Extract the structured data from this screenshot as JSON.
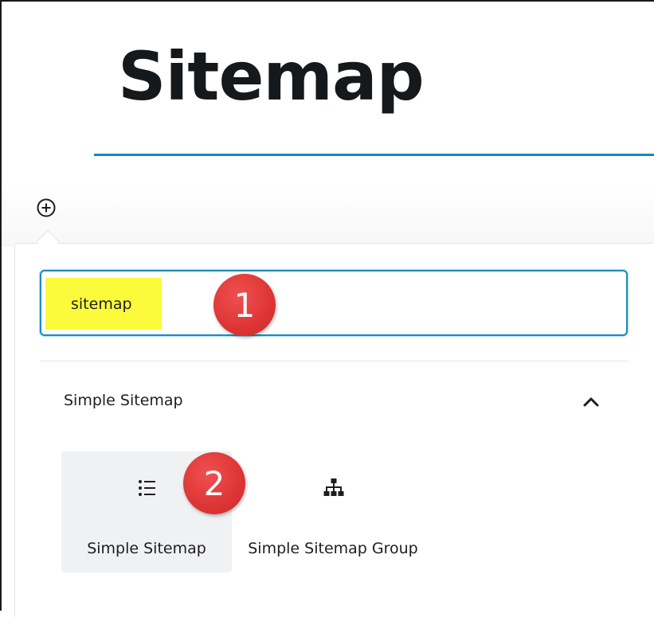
{
  "page": {
    "title": "Sitemap"
  },
  "inserter": {
    "add_block_icon": "plus-circle-icon",
    "search": {
      "value": "sitemap",
      "highlight_color": "#fbfb3c",
      "focus_color": "#1e8cbe"
    },
    "panel": {
      "title": "Simple Sitemap",
      "toggle_icon": "chevron-up-icon",
      "blocks": [
        {
          "label": "Simple Sitemap",
          "icon": "list-icon",
          "selected": true
        },
        {
          "label": "Simple Sitemap Group",
          "icon": "sitemap-tree-icon",
          "selected": false
        }
      ]
    }
  },
  "annotations": {
    "step_1": "1",
    "step_2": "2",
    "badge_color": "#dd3535"
  },
  "colors": {
    "title_rule": "#1589c4"
  }
}
